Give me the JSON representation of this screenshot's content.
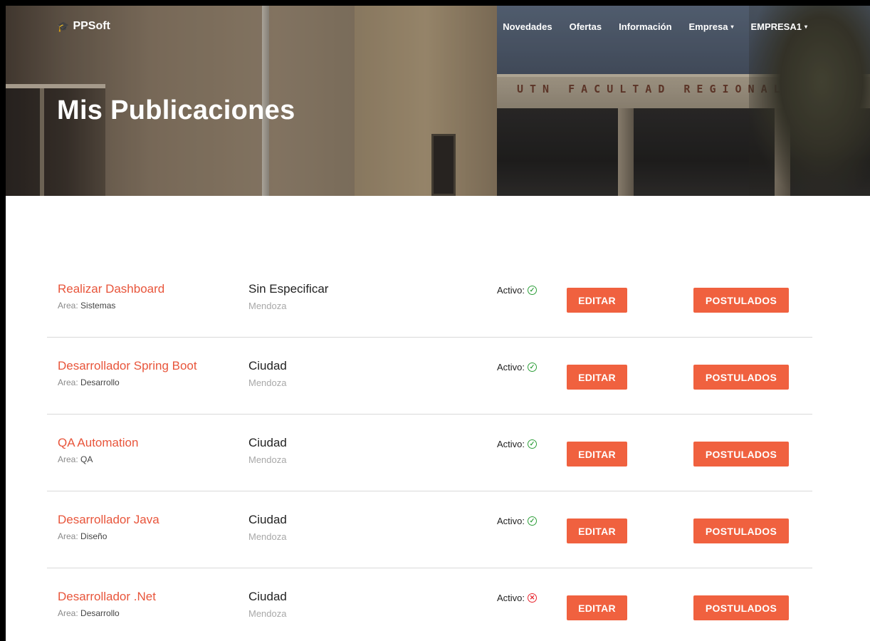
{
  "brand": {
    "name": "PPSoft",
    "icon": "graduation-cap-icon"
  },
  "nav": {
    "items": [
      {
        "label": "Novedades",
        "dropdown": false
      },
      {
        "label": "Ofertas",
        "dropdown": false
      },
      {
        "label": "Información",
        "dropdown": false
      },
      {
        "label": "Empresa",
        "dropdown": true
      },
      {
        "label": "EMPRESA1",
        "dropdown": true
      }
    ]
  },
  "hero": {
    "title": "Mis Publicaciones",
    "sign_text": "UTN FACULTAD REGIONAL ME"
  },
  "colors": {
    "accent": "#f0613f",
    "link": "#e8553b",
    "active_ok": "#2e9e3a",
    "active_bad": "#e8242d"
  },
  "publications": [
    {
      "title": "Realizar Dashboard",
      "area_label": "Area:",
      "area": "Sistemas",
      "location": "Sin Especificar",
      "city": "Mendoza",
      "status_label": "Activo:",
      "active": true,
      "edit_label": "EDITAR",
      "applicants_label": "POSTULADOS"
    },
    {
      "title": "Desarrollador Spring Boot",
      "area_label": "Area:",
      "area": "Desarrollo",
      "location": "Ciudad",
      "city": "Mendoza",
      "status_label": "Activo:",
      "active": true,
      "edit_label": "EDITAR",
      "applicants_label": "POSTULADOS"
    },
    {
      "title": "QA Automation",
      "area_label": "Area:",
      "area": "QA",
      "location": "Ciudad",
      "city": "Mendoza",
      "status_label": "Activo:",
      "active": true,
      "edit_label": "EDITAR",
      "applicants_label": "POSTULADOS"
    },
    {
      "title": "Desarrollador Java",
      "area_label": "Area:",
      "area": "Diseño",
      "location": "Ciudad",
      "city": "Mendoza",
      "status_label": "Activo:",
      "active": true,
      "edit_label": "EDITAR",
      "applicants_label": "POSTULADOS"
    },
    {
      "title": "Desarrollador .Net",
      "area_label": "Area:",
      "area": "Desarrollo",
      "location": "Ciudad",
      "city": "Mendoza",
      "status_label": "Activo:",
      "active": false,
      "edit_label": "EDITAR",
      "applicants_label": "POSTULADOS"
    }
  ]
}
